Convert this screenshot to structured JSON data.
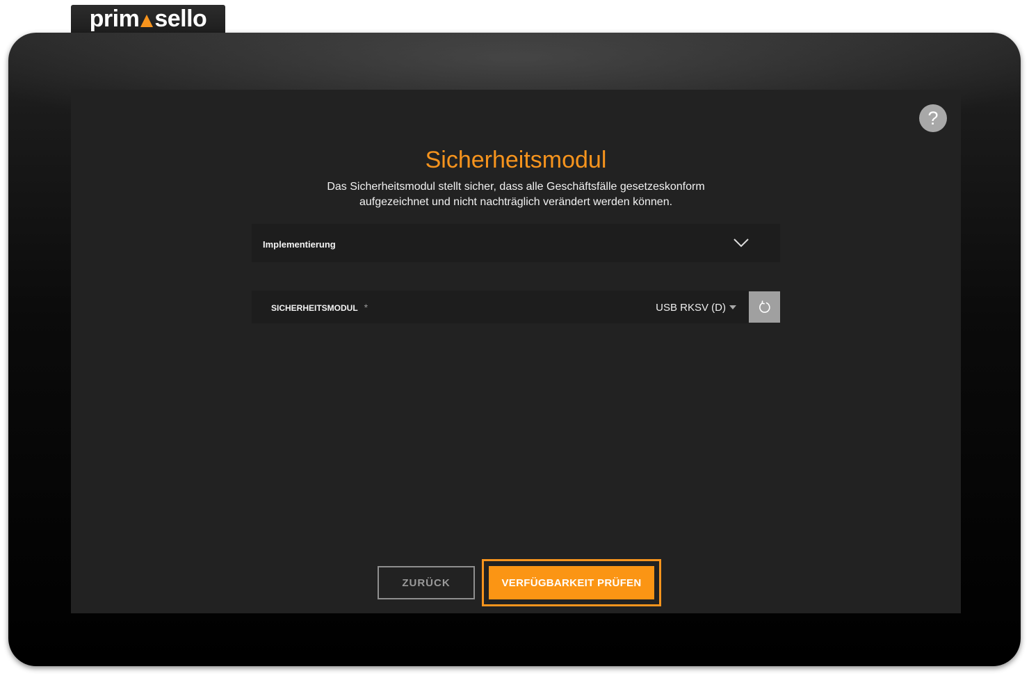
{
  "logo": {
    "part1": "prim",
    "part2": "sello",
    "mark_icon": "triangle-mark-icon"
  },
  "colors": {
    "accent": "#f7941d",
    "screen_background": "#222222",
    "row_background": "#1d1d1d",
    "refresh_button": "#a0a0a0",
    "help_button": "#a8a8a8"
  },
  "help": {
    "label": "?"
  },
  "title": "Sicherheitsmodul",
  "description": [
    "Das Sicherheitsmodul stellt sicher, dass alle Geschäftsfälle gesetzeskonform",
    "aufgezeichnet und nicht nachträglich verändert werden können."
  ],
  "accordion": {
    "label": "Implementierung",
    "icon": "chevron-down-icon"
  },
  "field": {
    "label": "SICHERHEITSMODUL",
    "required_marker": "*",
    "value": "USB RKSV (D)",
    "dropdown_icon": "caret-down-icon",
    "refresh_icon": "refresh-icon"
  },
  "buttons": {
    "back": "ZURÜCK",
    "check": "VERFÜGBARKEIT PRÜFEN"
  }
}
